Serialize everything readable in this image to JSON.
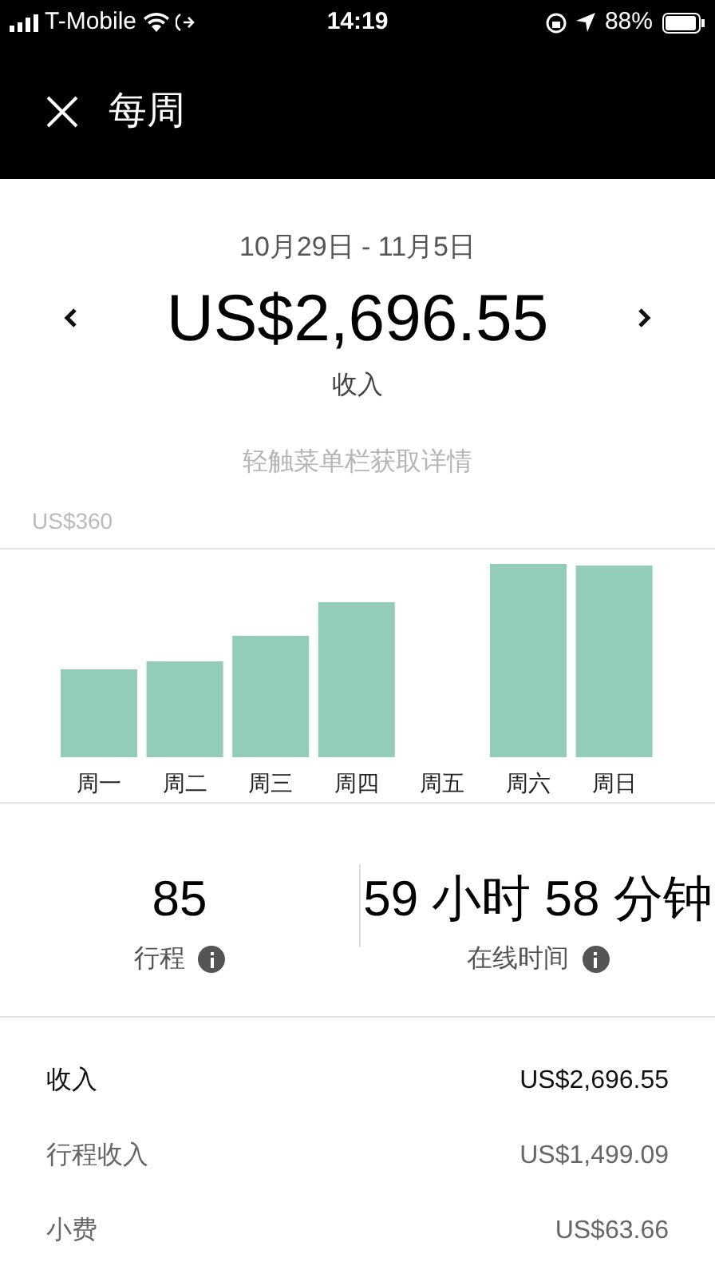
{
  "status_bar": {
    "carrier": "T-Mobile",
    "time": "14:19",
    "battery": "88%"
  },
  "header": {
    "title": "每周"
  },
  "summary": {
    "date_range": "10月29日 - 11月5日",
    "amount": "US$2,696.55",
    "amount_label": "收入",
    "hint": "轻触菜单栏获取详情"
  },
  "chart": {
    "scale_label": "US$360",
    "days": [
      "周一",
      "周二",
      "周三",
      "周四",
      "周五",
      "周六",
      "周日"
    ]
  },
  "stats": [
    {
      "value": "85",
      "label": "行程"
    },
    {
      "value": "59 小时 58 分钟",
      "label": "在线时间"
    }
  ],
  "breakdown": [
    {
      "label": "收入",
      "amount": "US$2,696.55",
      "kind": "total"
    },
    {
      "label": "行程收入",
      "amount": "US$1,499.09",
      "kind": "item"
    },
    {
      "label": "小费",
      "amount": "US$63.66",
      "kind": "item"
    }
  ]
}
